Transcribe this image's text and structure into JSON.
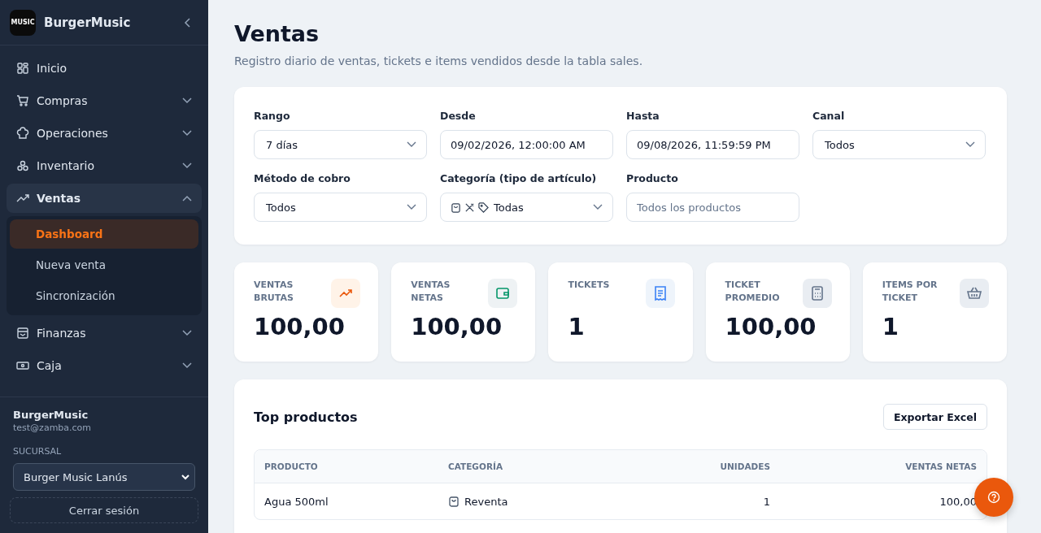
{
  "sidebar": {
    "brand": "BurgerMusic",
    "logo_text": "MUSIC",
    "items": [
      {
        "label": "Inicio",
        "kind": "grid",
        "expandable": false,
        "selected": false
      },
      {
        "label": "Compras",
        "kind": "cart",
        "expandable": true,
        "expanded": false,
        "selected": false
      },
      {
        "label": "Operaciones",
        "kind": "chef",
        "expandable": true,
        "expanded": false,
        "selected": false
      },
      {
        "label": "Inventario",
        "kind": "boxes",
        "expandable": true,
        "expanded": false,
        "selected": false
      },
      {
        "label": "Ventas",
        "kind": "trend",
        "expandable": true,
        "expanded": true,
        "selected": true,
        "children": [
          {
            "label": "Dashboard",
            "selected": true
          },
          {
            "label": "Nueva venta",
            "selected": false
          },
          {
            "label": "Sincronización",
            "selected": false
          }
        ]
      },
      {
        "label": "Finanzas",
        "kind": "archive",
        "expandable": true,
        "expanded": false,
        "selected": false
      },
      {
        "label": "Caja",
        "kind": "cash",
        "expandable": true,
        "expanded": false,
        "selected": false
      }
    ],
    "user": {
      "name": "BurgerMusic",
      "email": "test@zamba.com"
    },
    "branch_label": "SUCURSAL",
    "branch_value": "Burger Music Lanús",
    "logout": "Cerrar sesión"
  },
  "page": {
    "title": "Ventas",
    "subtitle": "Registro diario de ventas, tickets e items vendidos desde la tabla sales."
  },
  "filters": [
    {
      "label": "Rango",
      "kind": "select",
      "value": "7 días"
    },
    {
      "label": "Desde",
      "kind": "input",
      "value": "09/02/2026, 12:00:00 AM"
    },
    {
      "label": "Hasta",
      "kind": "input",
      "value": "09/08/2026, 11:59:59 PM"
    },
    {
      "label": "Canal",
      "kind": "select",
      "value": "Todos"
    },
    {
      "label": "Método de cobro",
      "kind": "select",
      "value": "Todos"
    },
    {
      "label": "Categoría (tipo de artículo)",
      "kind": "category",
      "value": "Todas"
    },
    {
      "label": "Producto",
      "kind": "input",
      "placeholder": "Todos los productos"
    }
  ],
  "stats": [
    {
      "label": "VENTAS BRUTAS",
      "value": "100,00",
      "kind": "trend"
    },
    {
      "label": "VENTAS NETAS",
      "value": "100,00",
      "kind": "wallet"
    },
    {
      "label": "TICKETS",
      "value": "1",
      "kind": "receipt"
    },
    {
      "label": "TICKET PROMEDIO",
      "value": "100,00",
      "kind": "calculator"
    },
    {
      "label": "ITEMS POR TICKET",
      "value": "1",
      "kind": "basket"
    }
  ],
  "top_products": {
    "title": "Top productos",
    "export": "Exportar Excel",
    "columns": [
      "PRODUCTO",
      "CATEGORÍA",
      "UNIDADES",
      "VENTAS NETAS"
    ],
    "rows": [
      {
        "product": "Agua 500ml",
        "category": "Reventa",
        "units": "1",
        "net": "100,00"
      }
    ]
  }
}
